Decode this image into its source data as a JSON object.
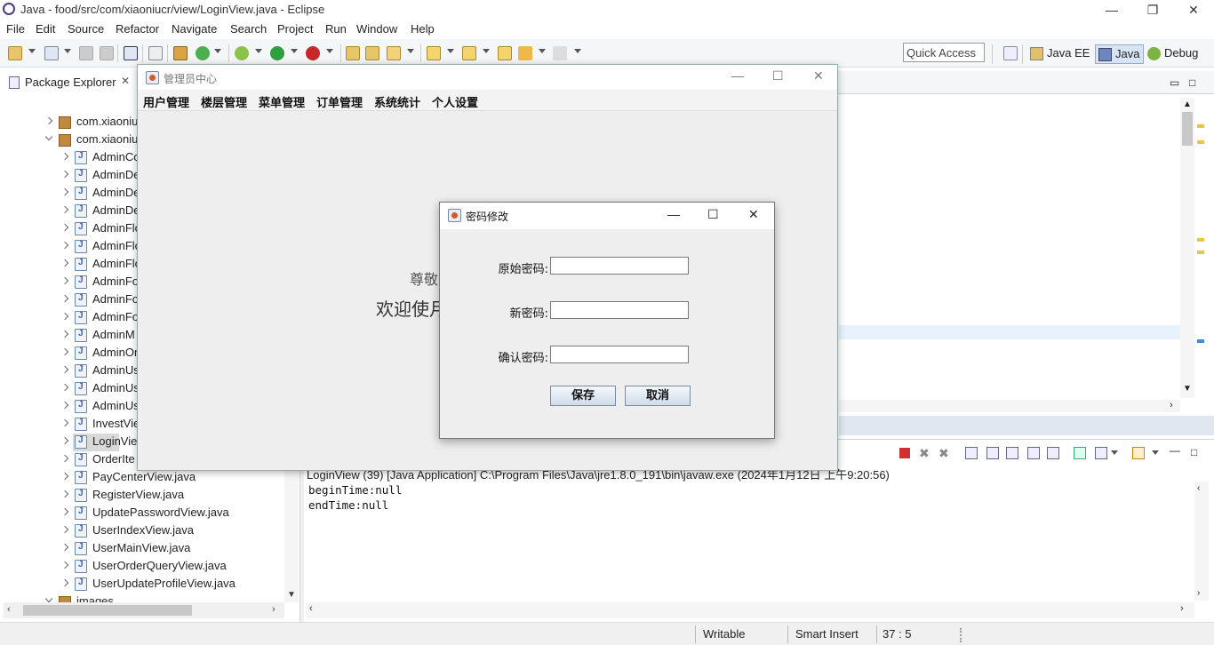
{
  "eclipse": {
    "title": "Java - food/src/com/xiaoniucr/view/LoginView.java - Eclipse",
    "menu": [
      "File",
      "Edit",
      "Source",
      "Refactor",
      "Navigate",
      "Search",
      "Project",
      "Run",
      "Window",
      "Help"
    ],
    "quick_access": "Quick Access",
    "perspectives": [
      "Java EE",
      "Java",
      "Debug"
    ]
  },
  "package_explorer": {
    "tab": "Package Explorer",
    "rows": [
      {
        "label": "com.xiaoniu",
        "kind": "package",
        "expanded": false
      },
      {
        "label": "com.xiaoniu",
        "kind": "package",
        "expanded": true
      },
      {
        "label": "AdminCo",
        "kind": "java"
      },
      {
        "label": "AdminDe",
        "kind": "java"
      },
      {
        "label": "AdminDe",
        "kind": "java"
      },
      {
        "label": "AdminDe",
        "kind": "java"
      },
      {
        "label": "AdminFlo",
        "kind": "java"
      },
      {
        "label": "AdminFlo",
        "kind": "java"
      },
      {
        "label": "AdminFlo",
        "kind": "java"
      },
      {
        "label": "AdminFo",
        "kind": "java"
      },
      {
        "label": "AdminFo",
        "kind": "java"
      },
      {
        "label": "AdminFo",
        "kind": "java"
      },
      {
        "label": "AdminM",
        "kind": "java"
      },
      {
        "label": "AdminOr",
        "kind": "java"
      },
      {
        "label": "AdminUs",
        "kind": "java"
      },
      {
        "label": "AdminUs",
        "kind": "java"
      },
      {
        "label": "AdminUs",
        "kind": "java"
      },
      {
        "label": "InvestVie",
        "kind": "java"
      },
      {
        "label": "LoginView",
        "kind": "java",
        "selected": true
      },
      {
        "label": "OrderIte",
        "kind": "java"
      },
      {
        "label": "PayCenterView.java",
        "kind": "java"
      },
      {
        "label": "RegisterView.java",
        "kind": "java"
      },
      {
        "label": "UpdatePasswordView.java",
        "kind": "java"
      },
      {
        "label": "UserIndexView.java",
        "kind": "java"
      },
      {
        "label": "UserMainView.java",
        "kind": "java"
      },
      {
        "label": "UserOrderQueryView.java",
        "kind": "java"
      },
      {
        "label": "UserUpdateProfileView.java",
        "kind": "java"
      },
      {
        "label": "images",
        "kind": "folder"
      }
    ]
  },
  "console": {
    "header": "LoginView (39) [Java Application] C:\\Program Files\\Java\\jre1.8.0_191\\bin\\javaw.exe (2024年1月12日 上午9:20:56)",
    "lines": [
      "beginTime:null",
      "endTime:null"
    ]
  },
  "status": {
    "writable": "Writable",
    "insert_mode": "Smart Insert",
    "position": "37 : 5"
  },
  "admin_window": {
    "title": "管理员中心",
    "menu": [
      "用户管理",
      "楼层管理",
      "菜单管理",
      "订单管理",
      "系统统计",
      "个人设置"
    ],
    "greeting": "尊敬",
    "welcome": "欢迎使月"
  },
  "password_dialog": {
    "title": "密码修改",
    "labels": {
      "old": "原始密码:",
      "new": "新密码:",
      "confirm": "确认密码:"
    },
    "values": {
      "old": "",
      "new": "",
      "confirm": ""
    },
    "save": "保存",
    "cancel": "取消"
  }
}
